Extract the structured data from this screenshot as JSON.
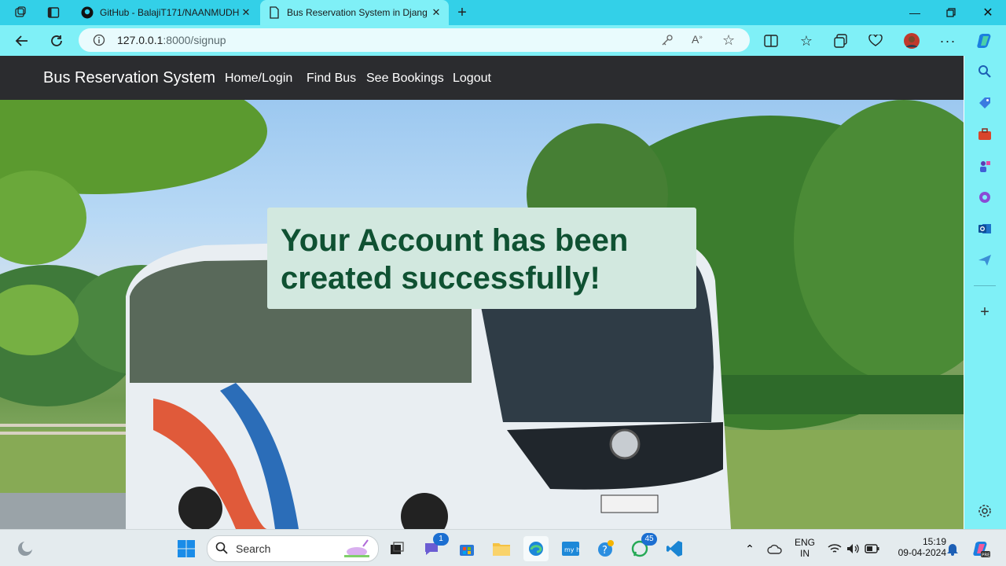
{
  "browser": {
    "tabs": [
      {
        "label": "GitHub - BalajiT171/NAANMUDH",
        "icon": "github-icon"
      },
      {
        "label": "Bus Reservation System in Djang",
        "icon": "page-icon",
        "active": true
      }
    ],
    "address": {
      "host": "127.0.0.1",
      "path": ":8000/signup"
    }
  },
  "site": {
    "brand": "Bus Reservation System",
    "nav": [
      "Home/Login",
      "Find Bus",
      "See Bookings",
      "Logout"
    ],
    "alert": "Your Account has been created successfully!",
    "alert_color": "#0f5132"
  },
  "taskbar": {
    "search_placeholder": "Search",
    "badges": {
      "teams": "1",
      "whatsapp": "45"
    },
    "lang": {
      "top": "ENG",
      "bottom": "IN"
    },
    "time": "15:19",
    "date": "09-04-2024"
  }
}
